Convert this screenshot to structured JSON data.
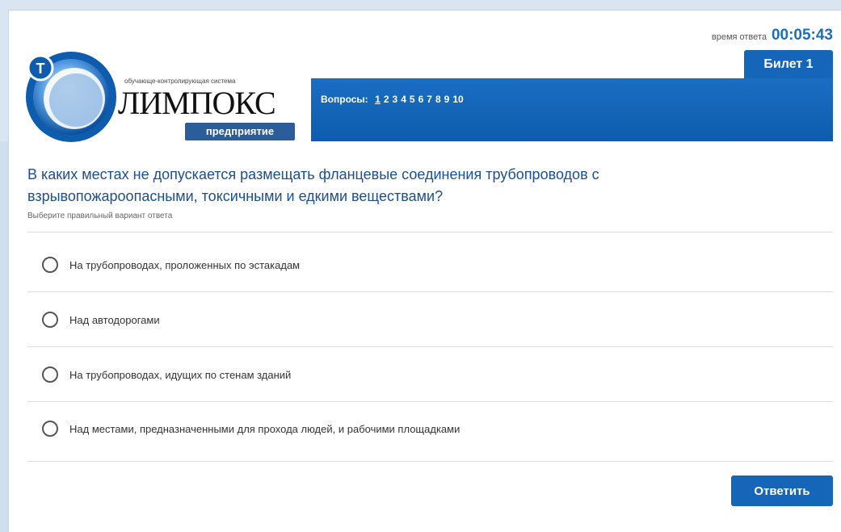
{
  "timer": {
    "label": "время ответа",
    "value": "00:05:43"
  },
  "logo": {
    "tagline": "обучающе-контролирующая система",
    "name": "ЛИМПОКС",
    "badge": "предприятие",
    "emblem_letter": "Т"
  },
  "ticket": {
    "label": "Билет 1"
  },
  "questions_nav": {
    "label": "Вопросы:",
    "numbers": [
      "1",
      "2",
      "3",
      "4",
      "5",
      "6",
      "7",
      "8",
      "9",
      "10"
    ],
    "current": "1"
  },
  "question": {
    "text": "В каких местах не допускается размещать фланцевые соединения трубопроводов с взрывопожароопасными, токсичными и едкими веществами?",
    "hint": "Выберите правильный вариант ответа"
  },
  "options": [
    "На трубопроводах, проложенных по эстакадам",
    "Над автодорогами",
    "На трубопроводах, идущих по стенам зданий",
    "Над местами, предназначенными для прохода людей, и рабочими площадками"
  ],
  "submit_label": "Ответить",
  "colors": {
    "brand_blue": "#1565b8",
    "question_text": "#1c4f8c"
  }
}
